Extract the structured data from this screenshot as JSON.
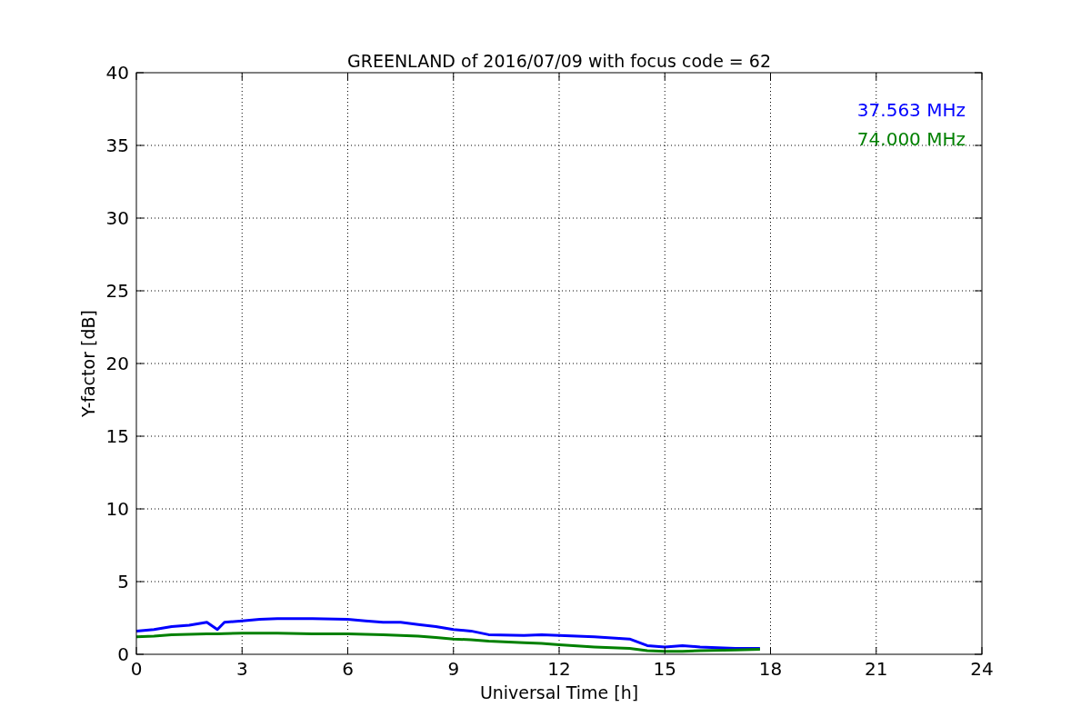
{
  "figure": {
    "chart_data": {
      "type": "line",
      "title": "GREENLAND of 2016/07/09 with focus code = 62",
      "xlabel": "Universal Time [h]",
      "ylabel": "Y-factor [dB]",
      "x": [
        0,
        0.5,
        1,
        1.5,
        2,
        2.3,
        2.5,
        3,
        3.5,
        4,
        5,
        6,
        6.5,
        7,
        7.5,
        8,
        8.5,
        9,
        9.5,
        10,
        11,
        11.5,
        12,
        13,
        14,
        14.5,
        15,
        15.5,
        16,
        17,
        17.7
      ],
      "series": [
        {
          "name": "37.563 MHz",
          "color": "#0000ff",
          "values": [
            1.6,
            1.7,
            1.9,
            2.0,
            2.2,
            1.7,
            2.2,
            2.3,
            2.4,
            2.45,
            2.45,
            2.4,
            2.3,
            2.2,
            2.2,
            2.05,
            1.9,
            1.7,
            1.6,
            1.35,
            1.3,
            1.35,
            1.3,
            1.2,
            1.05,
            0.6,
            0.5,
            0.6,
            0.5,
            0.4,
            0.4
          ]
        },
        {
          "name": "74.000 MHz",
          "color": "#008000",
          "values": [
            1.2,
            1.25,
            1.35,
            1.38,
            1.4,
            1.4,
            1.42,
            1.45,
            1.45,
            1.45,
            1.4,
            1.4,
            1.38,
            1.35,
            1.3,
            1.25,
            1.15,
            1.05,
            1.0,
            0.9,
            0.8,
            0.75,
            0.65,
            0.5,
            0.4,
            0.25,
            0.2,
            0.2,
            0.25,
            0.3,
            0.35
          ]
        }
      ],
      "xlim": [
        0,
        24
      ],
      "ylim": [
        0,
        40
      ],
      "xticks": [
        0,
        3,
        6,
        9,
        12,
        15,
        18,
        21,
        24
      ],
      "yticks": [
        0,
        5,
        10,
        15,
        20,
        25,
        30,
        35,
        40
      ],
      "grid": true
    }
  }
}
